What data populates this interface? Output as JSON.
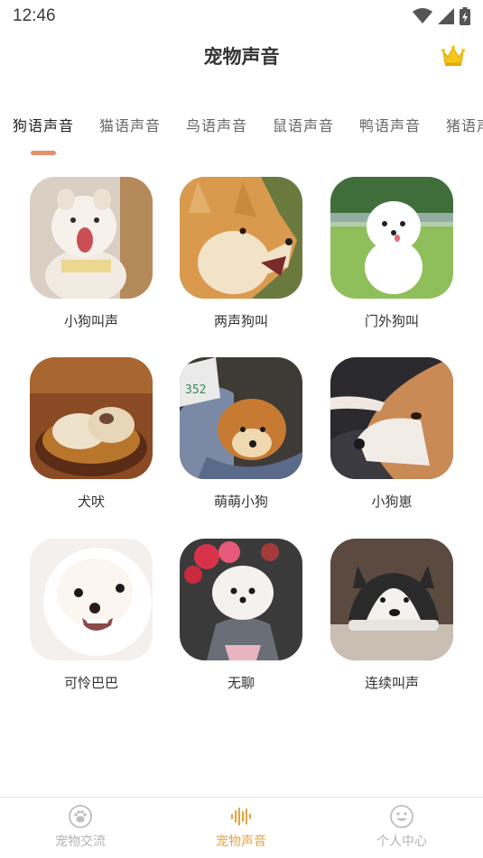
{
  "status_bar": {
    "time": "12:46"
  },
  "header": {
    "title": "宠物声音",
    "vip_icon": "crown-icon"
  },
  "tabs": [
    {
      "label": "狗语声音",
      "active": true
    },
    {
      "label": "猫语声音",
      "active": false
    },
    {
      "label": "鸟语声音",
      "active": false
    },
    {
      "label": "鼠语声音",
      "active": false
    },
    {
      "label": "鸭语声音",
      "active": false
    },
    {
      "label": "猪语声音",
      "active": false
    }
  ],
  "sounds": [
    {
      "label": "小狗叫声"
    },
    {
      "label": "两声狗叫"
    },
    {
      "label": "门外狗叫"
    },
    {
      "label": "犬吠"
    },
    {
      "label": "萌萌小狗"
    },
    {
      "label": "小狗崽"
    },
    {
      "label": "可怜巴巴"
    },
    {
      "label": "无聊"
    },
    {
      "label": "连续叫声"
    }
  ],
  "bottom_nav": [
    {
      "label": "宠物交流",
      "icon": "paw-icon",
      "active": false
    },
    {
      "label": "宠物声音",
      "icon": "soundwave-icon",
      "active": true
    },
    {
      "label": "个人中心",
      "icon": "smiley-icon",
      "active": false
    }
  ],
  "colors": {
    "accent": "#e8a23e",
    "tab_indicator": "#e5916a"
  }
}
